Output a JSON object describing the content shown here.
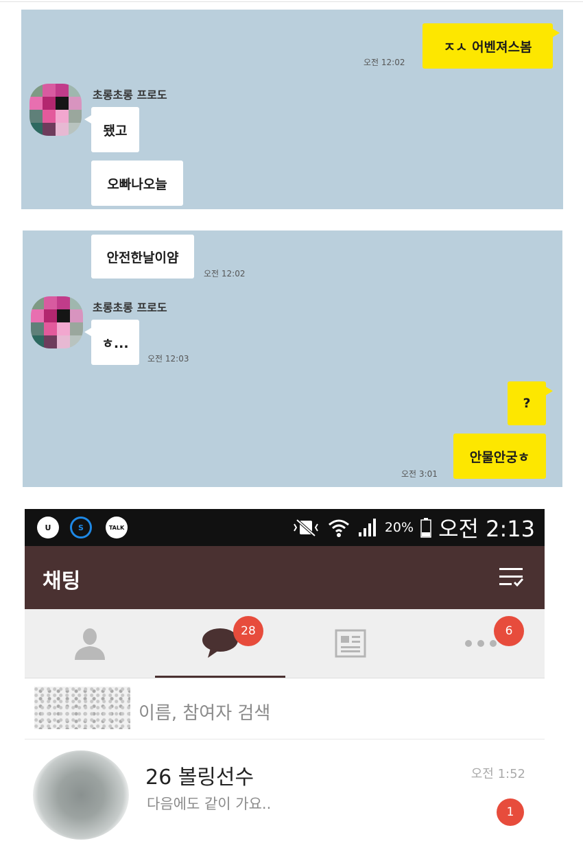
{
  "chat_top": {
    "messages": [
      {
        "text": "ㅈㅅ 어벤져스봄",
        "time": "오전 12:02"
      },
      {
        "sender": "초롱초롱 프로도",
        "text": "됐고"
      },
      {
        "text": "오빠나오늘"
      }
    ]
  },
  "chat_middle": {
    "messages": [
      {
        "text": "안전한날이얌",
        "time": "오전 12:02"
      },
      {
        "sender": "초롱초롱 프로도",
        "text": "ㅎ...",
        "time": "오전 12:03"
      },
      {
        "text": "?"
      },
      {
        "text": "안물안궁ㅎ",
        "time": "오전 3:01"
      }
    ]
  },
  "phone": {
    "status_bar": {
      "app_icons": [
        {
          "name": "u-icon",
          "label": "U",
          "color": "#ffffff"
        },
        {
          "name": "s-icon",
          "label": "S",
          "color": "#1e88e5"
        },
        {
          "name": "talk-icon",
          "label": "TALK",
          "color": "#ffffff"
        }
      ],
      "battery": "20%",
      "time": "오전 2:13"
    },
    "app_bar": {
      "title": "채팅"
    },
    "tabs": [
      {
        "name": "friends-tab",
        "icon": "person-icon"
      },
      {
        "name": "chats-tab",
        "icon": "speech-bubble-icon",
        "badge": "28"
      },
      {
        "name": "channel-tab",
        "icon": "newspaper-icon"
      },
      {
        "name": "more-tab",
        "icon": "more-icon",
        "badge": "6"
      }
    ],
    "search": {
      "placeholder": "이름, 참여자 검색"
    },
    "chat_list": [
      {
        "title": "26 볼링선수",
        "preview": "다음에도 같이 가요..",
        "time": "오전 1:52",
        "unread": "1"
      }
    ]
  },
  "colors": {
    "chat_background": "#bacfdc",
    "my_bubble": "#fde700",
    "app_bar": "#4a3131",
    "badge": "#e74c3c"
  }
}
